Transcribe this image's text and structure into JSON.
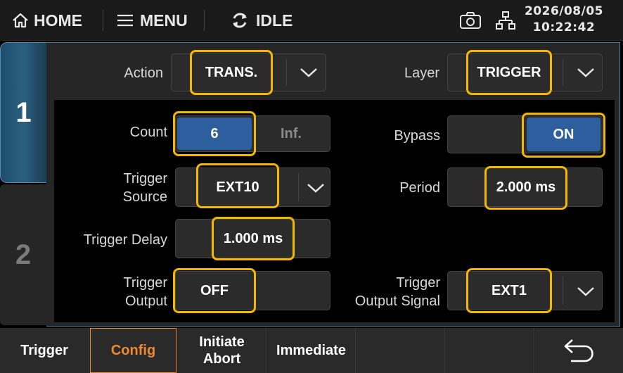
{
  "topbar": {
    "home_label": "HOME",
    "menu_label": "MENU",
    "status_label": "IDLE",
    "date": "2026/08/05",
    "time": "10:22:42"
  },
  "channels": [
    "1",
    "2"
  ],
  "config": {
    "action": {
      "label": "Action",
      "value": "TRANS."
    },
    "layer": {
      "label": "Layer",
      "value": "TRIGGER"
    },
    "count": {
      "label": "Count",
      "value": "6",
      "inf_label": "Inf."
    },
    "bypass": {
      "label": "Bypass",
      "value": "ON"
    },
    "trigger_source": {
      "label_line1": "Trigger",
      "label_line2": "Source",
      "value": "EXT10"
    },
    "period": {
      "label": "Period",
      "value": "2.000 ms"
    },
    "trigger_delay": {
      "label": "Trigger Delay",
      "value": "1.000 ms"
    },
    "trigger_output": {
      "label_line1": "Trigger",
      "label_line2": "Output",
      "value": "OFF"
    },
    "trigger_output_signal": {
      "label_line1": "Trigger",
      "label_line2": "Output Signal",
      "value": "EXT1"
    }
  },
  "softkeys": {
    "trigger": "Trigger",
    "config": "Config",
    "initiate_line1": "Initiate",
    "initiate_line2": "Abort",
    "immediate": "Immediate"
  },
  "colors": {
    "highlight": "#f5b800",
    "selected_blue": "#2d5f9e",
    "active_softkey": "#f08a2a"
  }
}
